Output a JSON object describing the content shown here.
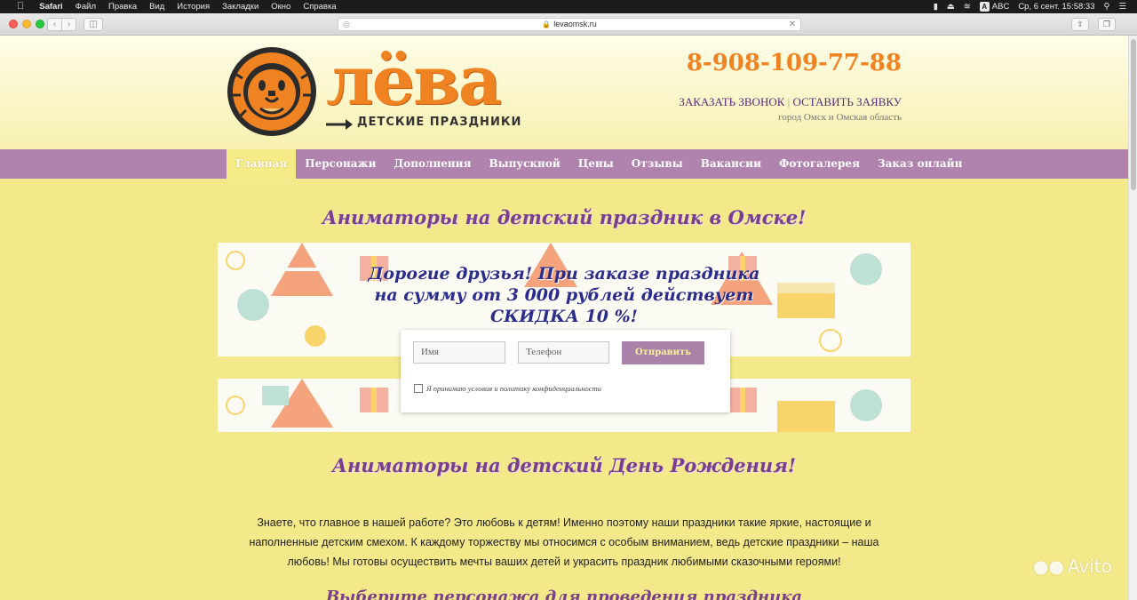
{
  "menubar": {
    "app": "Safari",
    "items": [
      "Файл",
      "Правка",
      "Вид",
      "История",
      "Закладки",
      "Окно",
      "Справка"
    ],
    "keyboard": "ABC",
    "datetime": "Ср, 6 сент.  15:58:33"
  },
  "browser": {
    "url": "levaomsk.ru"
  },
  "header": {
    "logo_word": "лёва",
    "logo_sub": "ДЕТСКИЕ ПРАЗДНИКИ",
    "phone": "8-908-109-77-88",
    "callback_label": "ЗАКАЗАТЬ ЗВОНОК",
    "separator": "|",
    "request_label": "ОСТАВИТЬ ЗАЯВКУ",
    "city": "город Омск и Омская область"
  },
  "nav": {
    "items": [
      "Главная",
      "Персонажи",
      "Дополнения",
      "Выпускной",
      "Цены",
      "Отзывы",
      "Вакансии",
      "Фотогалерея",
      "Заказ онлайн"
    ]
  },
  "main": {
    "title1": "Аниматоры на детский праздник в Омске!",
    "promo_line1": "Дорогие друзья! При заказе праздника",
    "promo_line2": "на сумму от 3 000 рублей действует",
    "promo_line3": "СКИДКА  10 %!",
    "form": {
      "name_placeholder": "Имя",
      "phone_placeholder": "Телефон",
      "submit_label": "Отправить",
      "agree_label": "Я принимаю условия и политику конфиденциальности"
    },
    "title2": "Аниматоры на детский День Рождения!",
    "body_text": "Знаете, что главное в нашей работе? Это любовь к детям! Именно поэтому наши праздники такие яркие, настоящие и наполненные детским смехом. К каждому торжеству мы относимся с особым вниманием, ведь детские праздники – наша любовь! Мы готовы осуществить мечты ваших детей и украсить праздник любимыми сказочными героями!",
    "title3": "Выберите персонажа для проведения праздника"
  },
  "watermark": "Avito",
  "colors": {
    "accent_orange": "#f08321",
    "nav_purple": "#b083ae",
    "title_purple": "#7a3f8a",
    "page_yellow": "#f3e98a"
  }
}
